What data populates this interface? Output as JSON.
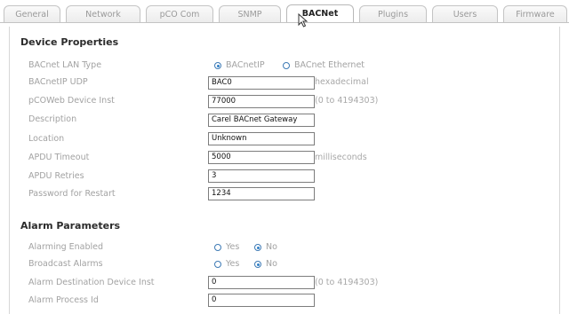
{
  "tabs": [
    {
      "label": "General"
    },
    {
      "label": "Network"
    },
    {
      "label": "pCO Com"
    },
    {
      "label": "SNMP"
    },
    {
      "label": "BACNet"
    },
    {
      "label": "Plugins"
    },
    {
      "label": "Users"
    },
    {
      "label": "Firmware"
    }
  ],
  "active_tab": "BACNet",
  "device": {
    "title": "Device Properties",
    "lan_type_label": "BACnet LAN Type",
    "lan_option_ip": "BACnetIP",
    "lan_option_eth": "BACnet Ethernet",
    "lan_selected": "BACnetIP",
    "udp_label": "BACnetIP UDP",
    "udp_value": "BAC0",
    "udp_hint": "hexadecimal",
    "inst_label": "pCOWeb Device Inst",
    "inst_value": "77000",
    "inst_hint": "(0 to 4194303)",
    "desc_label": "Description",
    "desc_value": "Carel BACnet Gateway",
    "loc_label": "Location",
    "loc_value": "Unknown",
    "timeout_label": "APDU Timeout",
    "timeout_value": "5000",
    "timeout_hint": "milliseconds",
    "retries_label": "APDU Retries",
    "retries_value": "3",
    "pwd_label": "Password for Restart",
    "pwd_value": "1234"
  },
  "alarm": {
    "title": "Alarm Parameters",
    "enabled_label": "Alarming Enabled",
    "broadcast_label": "Broadcast Alarms",
    "yes": "Yes",
    "no": "No",
    "enabled_selected": "No",
    "broadcast_selected": "No",
    "dest_label": "Alarm Destination Device Inst",
    "dest_value": "0",
    "dest_hint": "(0 to 4194303)",
    "pid_label": "Alarm Process Id",
    "pid_value": "0"
  },
  "colors": {
    "radio": "#2f7fc6",
    "label": "#a2a2a2",
    "title": "#2b2b2b"
  }
}
